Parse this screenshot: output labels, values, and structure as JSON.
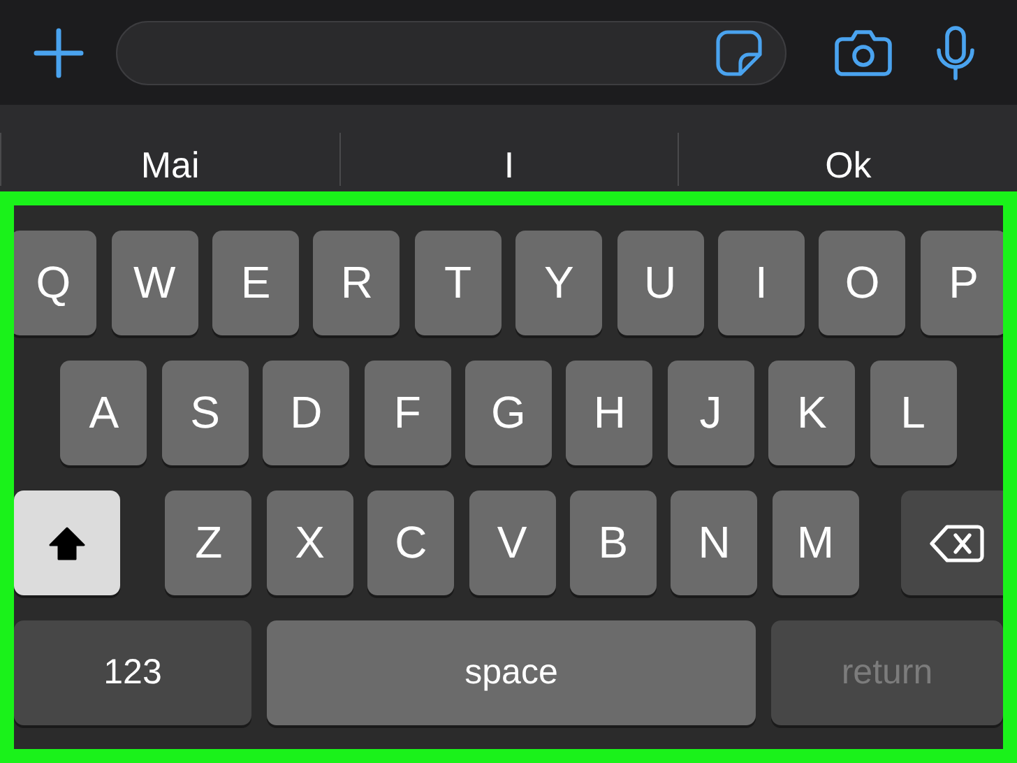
{
  "suggestions": [
    "Mai",
    "I",
    "Ok"
  ],
  "keyboard": {
    "highlighted": true,
    "rows": [
      {
        "keys": [
          {
            "kind": "letter",
            "label": "Q"
          },
          {
            "kind": "letter",
            "label": "W"
          },
          {
            "kind": "letter",
            "label": "E"
          },
          {
            "kind": "letter",
            "label": "R"
          },
          {
            "kind": "letter",
            "label": "T"
          },
          {
            "kind": "letter",
            "label": "Y"
          },
          {
            "kind": "letter",
            "label": "U"
          },
          {
            "kind": "letter",
            "label": "I"
          },
          {
            "kind": "letter",
            "label": "O"
          },
          {
            "kind": "letter",
            "label": "P"
          }
        ]
      },
      {
        "keys": [
          {
            "kind": "letter",
            "label": "A"
          },
          {
            "kind": "letter",
            "label": "S"
          },
          {
            "kind": "letter",
            "label": "D"
          },
          {
            "kind": "letter",
            "label": "F"
          },
          {
            "kind": "letter",
            "label": "G"
          },
          {
            "kind": "letter",
            "label": "H"
          },
          {
            "kind": "letter",
            "label": "J"
          },
          {
            "kind": "letter",
            "label": "K"
          },
          {
            "kind": "letter",
            "label": "L"
          }
        ]
      },
      {
        "keys": [
          {
            "kind": "shift",
            "on": true
          },
          {
            "kind": "letter",
            "label": "Z"
          },
          {
            "kind": "letter",
            "label": "X"
          },
          {
            "kind": "letter",
            "label": "C"
          },
          {
            "kind": "letter",
            "label": "V"
          },
          {
            "kind": "letter",
            "label": "B"
          },
          {
            "kind": "letter",
            "label": "N"
          },
          {
            "kind": "letter",
            "label": "M"
          },
          {
            "kind": "delete"
          }
        ]
      },
      {
        "keys": [
          {
            "kind": "numbers",
            "label": "123"
          },
          {
            "kind": "space",
            "label": "space"
          },
          {
            "kind": "return",
            "label": "return",
            "disabled": true
          }
        ]
      }
    ]
  }
}
